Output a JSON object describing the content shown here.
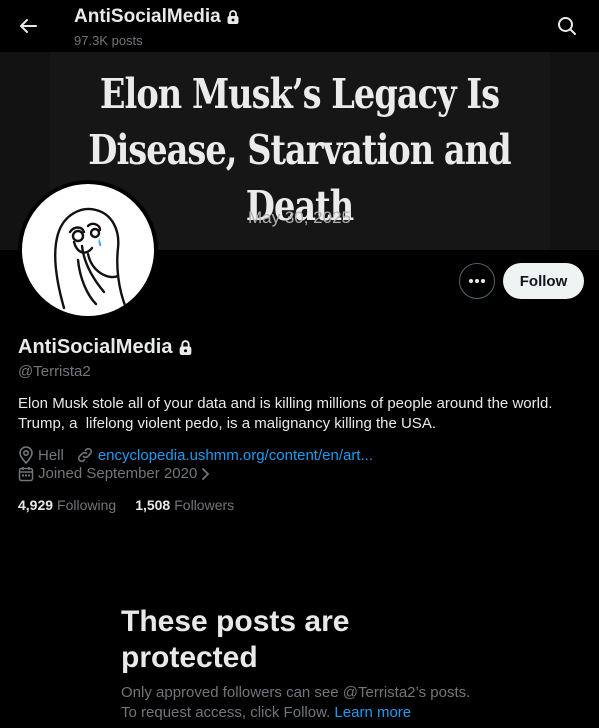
{
  "header": {
    "title": "AntiSocialMedia",
    "post_count": "97.3K posts"
  },
  "banner": {
    "headline_line1": "Elon Musk’s Legacy Is",
    "headline_line2": "Disease, Starvation and Death",
    "date": "May 30, 2025"
  },
  "actions": {
    "more_label": "More",
    "follow_label": "Follow"
  },
  "profile": {
    "name": "AntiSocialMedia",
    "handle": "@Terrista2",
    "bio": "Elon Musk stole all of your data and is killing millions of people around the world.\nTrump, a  lifelong violent pedo, is a malignancy killing the USA.",
    "location": "Hell",
    "website": "encyclopedia.ushmm.org/content/en/art...",
    "joined": "Joined September 2020"
  },
  "stats": {
    "following_count": "4,929",
    "following_label": "Following",
    "followers_count": "1,508",
    "followers_label": "Followers"
  },
  "protected": {
    "title_line1": "These posts are",
    "title_line2": "protected",
    "message_line1": "Only approved followers can see @Terrista2’s posts.",
    "message_line2": "To request access, click Follow.",
    "learn_more": "Learn more"
  },
  "icons": {
    "back": "arrow-left-icon",
    "search": "search-icon",
    "lock": "lock-icon",
    "more": "more-horizontal-icon",
    "location": "location-pin-icon",
    "link": "link-icon",
    "calendar": "calendar-icon",
    "chevron": "chevron-right-icon"
  },
  "colors": {
    "background": "#000000",
    "text_primary": "#e7e9ea",
    "text_secondary": "#71767b",
    "link": "#1d9bf0",
    "follow_button_bg": "#eff3f4"
  }
}
